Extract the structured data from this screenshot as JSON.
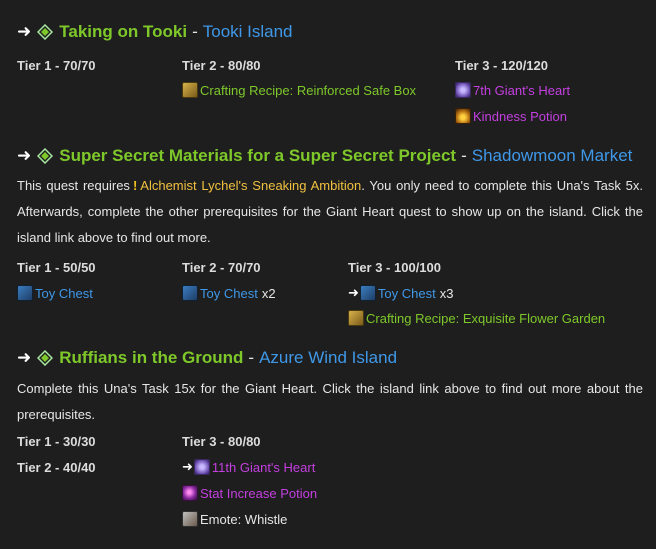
{
  "quests": [
    {
      "name": "Taking on Tooki",
      "sep": "-",
      "location": "Tooki Island",
      "tiers": [
        {
          "label": "Tier 1 - 70/70"
        },
        {
          "label": "Tier 2 - 80/80",
          "rewards": [
            {
              "text": "Crafting Recipe: Reinforced Safe Box",
              "icon": "recipe-icon"
            }
          ]
        },
        {
          "label": "Tier 3 - 120/120",
          "rewards": [
            {
              "text": "7th Giant's Heart",
              "icon": "giants-heart-icon"
            },
            {
              "text": "Kindness Potion",
              "icon": "potion-icon"
            }
          ]
        }
      ]
    },
    {
      "name": "Super Secret Materials for a Super Secret Project",
      "sep": "-",
      "location": "Shadowmoon Market",
      "desc_before": "This quest requires",
      "desc_exclaim": "!",
      "desc_link": "Alchemist Lychel's Sneaking Ambition",
      "desc_after": ". You only need to complete this Una's Task 5x. Afterwards, complete the other prerequisites for the Giant Heart quest to show up on the island. Click the island link above to find out more.",
      "tiers": [
        {
          "label": "Tier 1 - 50/50",
          "rewards": [
            {
              "text": "Toy Chest",
              "icon": "toy-chest-icon"
            }
          ]
        },
        {
          "label": "Tier 2 - 70/70",
          "rewards": [
            {
              "text": "Toy Chest",
              "qty": "x2",
              "icon": "toy-chest-icon"
            }
          ]
        },
        {
          "label": "Tier 3 - 100/100",
          "rewards": [
            {
              "text": "Toy Chest",
              "qty": "x3",
              "icon": "toy-chest-icon",
              "arrow": "➜"
            },
            {
              "text": "Crafting Recipe: Exquisite Flower Garden",
              "icon": "recipe-icon"
            }
          ]
        }
      ]
    },
    {
      "name": "Ruffians in the Ground",
      "sep": "-",
      "location": "Azure Wind Island",
      "desc": "Complete this Una's Task 15x for the Giant Heart. Click the island link above to find out more about the prerequisites.",
      "tiers": [
        {
          "label": "Tier 1 - 30/30"
        },
        {
          "label": "Tier 2 - 40/40"
        },
        {
          "label": "Tier 3 - 80/80",
          "rewards": [
            {
              "text": "11th Giant's Heart",
              "icon": "giants-heart-icon",
              "arrow": "➜"
            },
            {
              "text": "Stat Increase Potion",
              "icon": "stat-potion-icon"
            },
            {
              "text": "Emote: Whistle",
              "icon": "emote-icon"
            }
          ]
        }
      ]
    }
  ],
  "arrow": "➜",
  "colors": {
    "quest_name": "#7ec82a",
    "location": "#3f98e8",
    "rare_item": "#c43fe0",
    "background": "#1e1e1e"
  }
}
